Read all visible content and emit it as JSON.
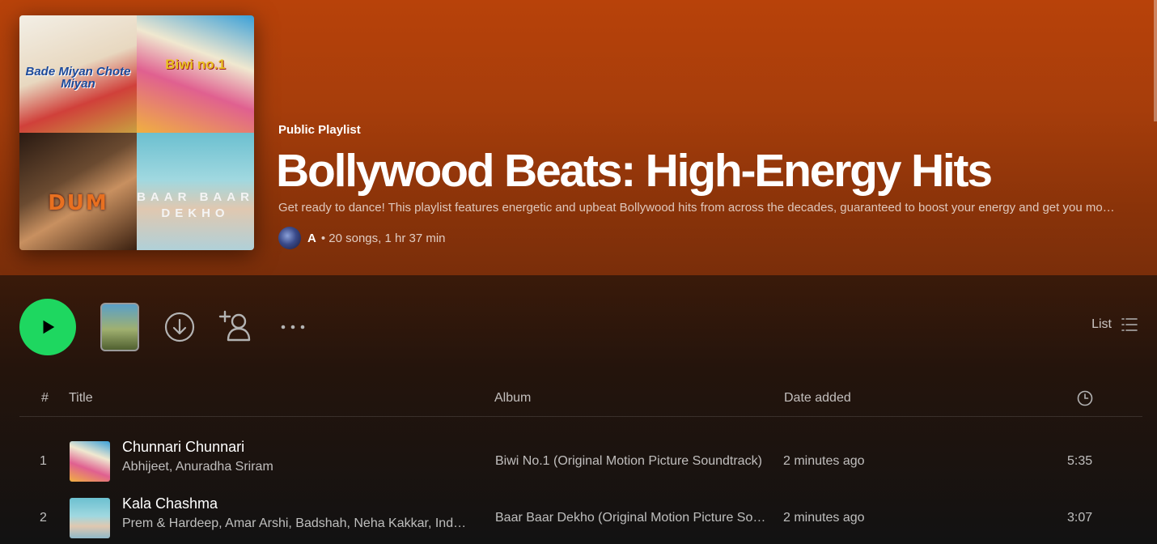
{
  "playlist": {
    "type_label": "Public Playlist",
    "title": "Bollywood Beats: High-Energy Hits",
    "description": "Get ready to dance! This playlist features energetic and upbeat Bollywood hits from across the decades, guaranteed to boost your energy and get you moving on the dance floor.",
    "owner": "A",
    "stats": "• 20 songs, 1 hr 37 min"
  },
  "cover_tiles": [
    {
      "text": "Bade Miyan Chote Miyan"
    },
    {
      "text": "Biwi no.1"
    },
    {
      "text": "DUM"
    },
    {
      "text": "BAAR BAAR DEKHO"
    }
  ],
  "controls": {
    "play_icon": "play-icon",
    "download_icon": "download-circle-icon",
    "follow_icon": "add-user-icon",
    "more_icon": "more-horizontal-icon",
    "view_label": "List",
    "view_icon": "list-icon"
  },
  "table": {
    "headers": {
      "num": "#",
      "title": "Title",
      "album": "Album",
      "date_added": "Date added",
      "duration_icon": "clock-icon"
    },
    "rows": [
      {
        "num": "1",
        "title": "Chunnari Chunnari",
        "artists": "Abhijeet, Anuradha Sriram",
        "album": "Biwi No.1 (Original Motion Picture Soundtrack)",
        "date_added": "2 minutes ago",
        "duration": "5:35"
      },
      {
        "num": "2",
        "title": "Kala Chashma",
        "artists": "Prem & Hardeep, Amar Arshi, Badshah, Neha Kakkar, Indeep Bakshi",
        "album": "Baar Baar Dekho (Original Motion Picture Soundtrack)",
        "date_added": "2 minutes ago",
        "duration": "3:07"
      }
    ]
  },
  "colors": {
    "accent_green": "#1ed760",
    "header_orange": "#b8420a",
    "background": "#121212"
  }
}
